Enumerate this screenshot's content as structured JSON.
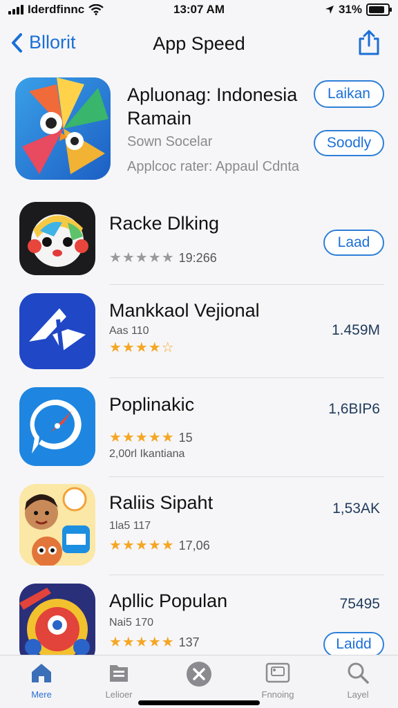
{
  "status": {
    "carrier": "Iderdfinnc",
    "time": "13:07 AM",
    "battery": "31%"
  },
  "nav": {
    "back_label": "Bllorit",
    "title": "App Speed"
  },
  "featured": {
    "title_line1": "Apluonag: Indonesia",
    "title_line2": "Ramain",
    "subtitle": "Sown Socelar",
    "caption": "Applcoc rater: Appaul Cdnta",
    "button1": "Laikan",
    "button2": "Soodly"
  },
  "apps": [
    {
      "name": "Racke Dlking",
      "rating_text": "19:266",
      "action": "Laad",
      "size": "",
      "sub": "",
      "sub2": ""
    },
    {
      "name": "Mankkaol Vejional",
      "rating_text": "",
      "action": "",
      "size": "1.459M",
      "sub": "Aas 110",
      "sub2": ""
    },
    {
      "name": "Poplinakic",
      "rating_text": "15",
      "action": "",
      "size": "1,6BIP6",
      "sub": "",
      "sub2": "2,00rl Ikantiana"
    },
    {
      "name": "Raliis Sipaht",
      "rating_text": "17,06",
      "action": "",
      "size": "1,53AK",
      "sub": "1la5 117",
      "sub2": ""
    },
    {
      "name": "Apllic Populan",
      "rating_text": "137",
      "action": "Laidd",
      "size": "75495",
      "sub": "Nai5 170",
      "sub2": ""
    }
  ],
  "tabs": [
    {
      "label": "Mere"
    },
    {
      "label": "Lelioer"
    },
    {
      "label": ""
    },
    {
      "label": "Fnnoing"
    },
    {
      "label": "Layel"
    }
  ],
  "colors": {
    "accent": "#1a6fd6",
    "star": "#f5a623",
    "star_gray": "#9a9a9e"
  }
}
